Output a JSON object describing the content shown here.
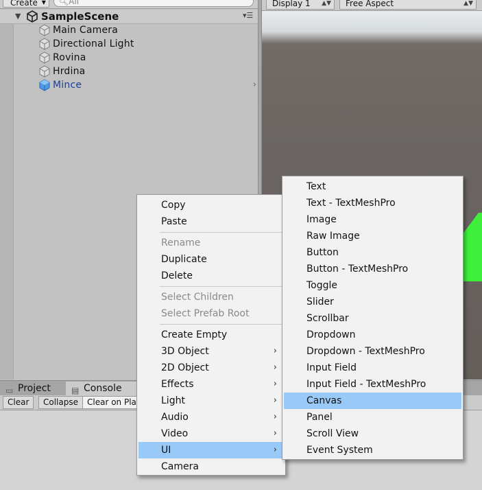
{
  "hierarchy": {
    "create_label": "Create",
    "search_placeholder": "All",
    "scene_name": "SampleScene",
    "objects": [
      {
        "label": "Main Camera",
        "selected": false
      },
      {
        "label": "Directional Light",
        "selected": false
      },
      {
        "label": "Rovina",
        "selected": false
      },
      {
        "label": "Hrdina",
        "selected": false
      },
      {
        "label": "Mince",
        "selected": true
      }
    ]
  },
  "game_view": {
    "display": "Display 1",
    "aspect": "Free Aspect"
  },
  "bottom_panel": {
    "tabs": [
      "Project",
      "Console"
    ],
    "buttons": [
      "Clear",
      "Collapse",
      "Clear on Play"
    ]
  },
  "context_menu": {
    "items": [
      "Copy",
      "Paste",
      "Rename",
      "Duplicate",
      "Delete",
      "Select Children",
      "Select Prefab Root",
      "Create Empty",
      "3D Object",
      "2D Object",
      "Effects",
      "Light",
      "Audio",
      "Video",
      "UI",
      "Camera"
    ]
  },
  "ui_submenu": {
    "items": [
      "Text",
      "Text - TextMeshPro",
      "Image",
      "Raw Image",
      "Button",
      "Button - TextMeshPro",
      "Toggle",
      "Slider",
      "Scrollbar",
      "Dropdown",
      "Dropdown - TextMeshPro",
      "Input Field",
      "Input Field - TextMeshPro",
      "Canvas",
      "Panel",
      "Scroll View",
      "Event System"
    ],
    "highlighted": "Canvas"
  },
  "colors": {
    "highlight": "#99c9f6",
    "selected_text": "#1a3d99",
    "green_object": "#3ef03b"
  }
}
